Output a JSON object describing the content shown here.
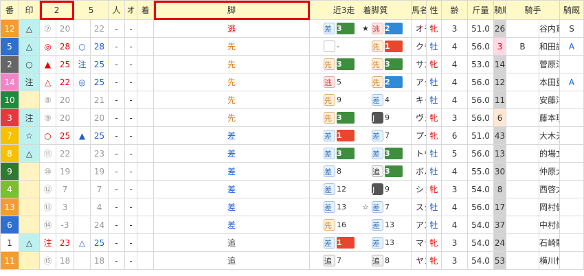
{
  "headers": [
    "番",
    "印",
    "2",
    "5",
    "人",
    "オ",
    "着",
    "脚",
    "近3走　着脚質",
    "馬名",
    "性",
    "齢",
    "斤量",
    "騎順",
    "",
    "騎手",
    "騎厩"
  ],
  "rows": [
    {
      "num": "12",
      "numColor": "orange",
      "mark": "△",
      "m2": "⑦",
      "v2": "20",
      "m5": "",
      "v5": "22",
      "hito": "-",
      "o": "-",
      "ak": "逃",
      "r1": {
        "tag": "差",
        "box": "3",
        "boxc": "green"
      },
      "r2": {
        "star": "★",
        "tag": "逃",
        "box": "2",
        "boxc": "blue"
      },
      "r3": {
        "tag": "逃",
        "box": "3",
        "boxc": "green"
      },
      "name": "オモルフォス",
      "sex": "牝",
      "age": "3",
      "weight": "51.0",
      "rank": "26",
      "rankc": "gray",
      "x": "",
      "jockey": "谷内貫",
      "kyu": "S"
    },
    {
      "num": "5",
      "numColor": "blue",
      "mark": "△",
      "m2": "◎",
      "v2": "28",
      "m5": "○",
      "v5": "28",
      "hito": "-",
      "o": "-",
      "ak": "先",
      "r1": {
        "tag": "",
        "sub": "-"
      },
      "r2": {
        "tag": "先",
        "box": "1",
        "boxc": "red"
      },
      "r3": {
        "tag": "先",
        "box": "1",
        "boxc": "red"
      },
      "name": "クチャモザクワジャ",
      "sex": "牡",
      "age": "4",
      "weight": "56.0",
      "rank": "3",
      "rankc": "pink",
      "x": "B",
      "jockey": "和田譲",
      "kyu": "A"
    },
    {
      "num": "2",
      "numColor": "gray",
      "mark": "○",
      "m2": "▲",
      "v2": "25",
      "m5": "注",
      "v5": "25",
      "hito": "-",
      "o": "-",
      "ak": "先",
      "r1": {
        "tag": "先",
        "box": "3",
        "boxc": "green"
      },
      "r2": {
        "tag": "先",
        "box": "3",
        "boxc": "green"
      },
      "r3": {
        "tag": "",
        "sub": "-"
      },
      "name": "サカベンクイーン",
      "sex": "牝",
      "age": "4",
      "weight": "53.0",
      "rank": "14",
      "rankc": "gray",
      "x": "",
      "jockey": "菅原涼",
      "kyu": ""
    },
    {
      "num": "14",
      "numColor": "pink",
      "mark": "注",
      "m2": "△",
      "v2": "22",
      "m5": "◎",
      "v5": "25",
      "hito": "-",
      "o": "-",
      "ak": "先",
      "r1": {
        "tag": "逃",
        "sub": "5"
      },
      "r2": {
        "tag": "先",
        "box": "2",
        "boxc": "blue"
      },
      "r3": {
        "tag": "",
        "sub": "-"
      },
      "name": "アタミセイコー",
      "sex": "牡",
      "age": "4",
      "weight": "56.0",
      "rank": "12",
      "rankc": "gray",
      "x": "",
      "jockey": "本田重",
      "kyu": "A"
    },
    {
      "num": "10",
      "numColor": "green",
      "mark": "",
      "m2": "⑧",
      "v2": "20",
      "m5": "",
      "v5": "21",
      "hito": "-",
      "o": "-",
      "ak": "先",
      "r1": {
        "tag": "先",
        "sub": "9"
      },
      "r2": {
        "tag": "差",
        "sub": "4"
      },
      "r3": {
        "tag": "先",
        "sub": "5"
      },
      "name": "キャストロゲイル",
      "sex": "牡",
      "age": "4",
      "weight": "56.0",
      "rank": "11",
      "rankc": "gray",
      "x": "",
      "jockey": "安藤洋",
      "kyu": ""
    },
    {
      "num": "3",
      "numColor": "red",
      "mark": "注",
      "m2": "⑨",
      "v2": "20",
      "m5": "",
      "v5": "20",
      "hito": "-",
      "o": "-",
      "ak": "先",
      "r1": {
        "tag": "先",
        "box": "3",
        "boxc": "green"
      },
      "r2": {
        "tag": "J",
        "sub": "9"
      },
      "r3": {
        "tag": "J",
        "sub": "16"
      },
      "name": "ヴェラグエリエロ",
      "sex": "牝",
      "age": "3",
      "weight": "56.0",
      "rank": "6",
      "rankc": "peach",
      "x": "",
      "jockey": "藤本現",
      "kyu": ""
    },
    {
      "num": "7",
      "numColor": "yellow",
      "mark": "☆",
      "m2": "○",
      "v2": "25",
      "m5": "▲",
      "v5": "25",
      "hito": "-",
      "o": "-",
      "ak": "差",
      "r1": {
        "tag": "差",
        "box": "1",
        "boxc": "red"
      },
      "r2": {
        "tag": "差",
        "sub": "7"
      },
      "r3": {
        "tag": "",
        "sub": "-"
      },
      "name": "プーラン",
      "sex": "牝",
      "age": "6",
      "weight": "51.0",
      "rank": "43",
      "rankc": "gray",
      "x": "",
      "jockey": "大木天",
      "kyu": ""
    },
    {
      "num": "8",
      "numColor": "yellow",
      "mark": "△",
      "m2": "⑪",
      "v2": "22",
      "m5": "",
      "v5": "23",
      "hito": "-",
      "o": "-",
      "ak": "差",
      "r1": {
        "tag": "差",
        "box": "3",
        "boxc": "green"
      },
      "r2": {
        "tag": "差",
        "box": "3",
        "boxc": "green"
      },
      "r3": {
        "tag": "差",
        "box": "2",
        "boxc": "blue"
      },
      "name": "トウキョウスター",
      "sex": "牡",
      "age": "5",
      "weight": "56.0",
      "rank": "13",
      "rankc": "gray",
      "x": "",
      "jockey": "的場文",
      "kyu": ""
    },
    {
      "num": "9",
      "numColor": "darkgreen",
      "mark": "",
      "m2": "⑩",
      "v2": "19",
      "m5": "",
      "v5": "19",
      "hito": "-",
      "o": "-",
      "ak": "差",
      "r1": {
        "tag": "差",
        "sub": "8"
      },
      "r2": {
        "tag": "追",
        "box": "3",
        "boxc": "green"
      },
      "r3": {
        "tag": "差",
        "sub": "7"
      },
      "name": "ボルトディタリー",
      "sex": "牡",
      "age": "4",
      "weight": "55.0",
      "rank": "30",
      "rankc": "gray",
      "x": "",
      "jockey": "仲原大",
      "kyu": ""
    },
    {
      "num": "4",
      "numColor": "lime",
      "mark": "",
      "m2": "⑫",
      "v2": "7",
      "m5": "",
      "v5": "7",
      "hito": "-",
      "o": "-",
      "ak": "差",
      "r1": {
        "tag": "差",
        "sub": "12"
      },
      "r2": {
        "tag": "J",
        "sub": "9"
      },
      "r3": {
        "tag": "J",
        "sub": "14"
      },
      "name": "ショウナンアウリイ",
      "sex": "牝",
      "age": "3",
      "weight": "54.0",
      "rank": "8",
      "rankc": "gray",
      "x": "",
      "jockey": "西啓太",
      "kyu": ""
    },
    {
      "num": "13",
      "numColor": "orange",
      "mark": "",
      "m2": "⑬",
      "v2": "3",
      "m5": "",
      "v5": "4",
      "hito": "-",
      "o": "-",
      "ak": "差",
      "r1": {
        "tag": "差",
        "sub": "13"
      },
      "r2": {
        "tag": "差",
        "sub": "7",
        "star": "☆"
      },
      "r3": {
        "tag": "差",
        "sub": "19"
      },
      "name": "スターオブボニータ",
      "sex": "牡",
      "age": "4",
      "weight": "56.0",
      "rank": "17",
      "rankc": "gray",
      "x": "",
      "jockey": "岡村健",
      "kyu": ""
    },
    {
      "num": "6",
      "numColor": "blue",
      "mark": "",
      "m2": "⑭",
      "v2": "-3",
      "m5": "",
      "v5": "24",
      "hito": "-",
      "o": "-",
      "ak": "差",
      "r1": {
        "tag": "先",
        "sub": "16"
      },
      "r2": {
        "tag": "差",
        "sub": "13"
      },
      "r3": {
        "tag": "追",
        "sub": "13"
      },
      "name": "アンジーニョ",
      "sex": "牡",
      "age": "4",
      "weight": "54.0",
      "rank": "37",
      "rankc": "gray",
      "x": "",
      "jockey": "中村尚",
      "kyu": ""
    },
    {
      "num": "1",
      "numColor": "white",
      "mark": "△",
      "m2": "注",
      "v2": "23",
      "m5": "△",
      "v5": "25",
      "hito": "-",
      "o": "-",
      "ak": "追",
      "r1": {
        "tag": "差",
        "box": "1",
        "boxc": "red"
      },
      "r2": {
        "tag": "差",
        "sub": "13"
      },
      "r3": {
        "tag": "差",
        "sub": "12"
      },
      "name": "マテラハチイチ",
      "sex": "牝",
      "age": "3",
      "weight": "54.0",
      "rank": "24",
      "rankc": "gray",
      "x": "",
      "jockey": "石崎駿",
      "kyu": ""
    },
    {
      "num": "11",
      "numColor": "orange",
      "mark": "",
      "m2": "⑮",
      "v2": "18",
      "m5": "",
      "v5": "18",
      "hito": "-",
      "o": "-",
      "ak": "追",
      "r1": {
        "tag": "追",
        "sub": "7"
      },
      "r2": {
        "tag": "追",
        "sub": "8"
      },
      "r3": {
        "tag": "追",
        "sub": "13"
      },
      "name": "ヤンノカステップ",
      "sex": "牝",
      "age": "3",
      "weight": "54.0",
      "rank": "53",
      "rankc": "gray",
      "x": "",
      "jockey": "横川怜",
      "kyu": ""
    }
  ]
}
